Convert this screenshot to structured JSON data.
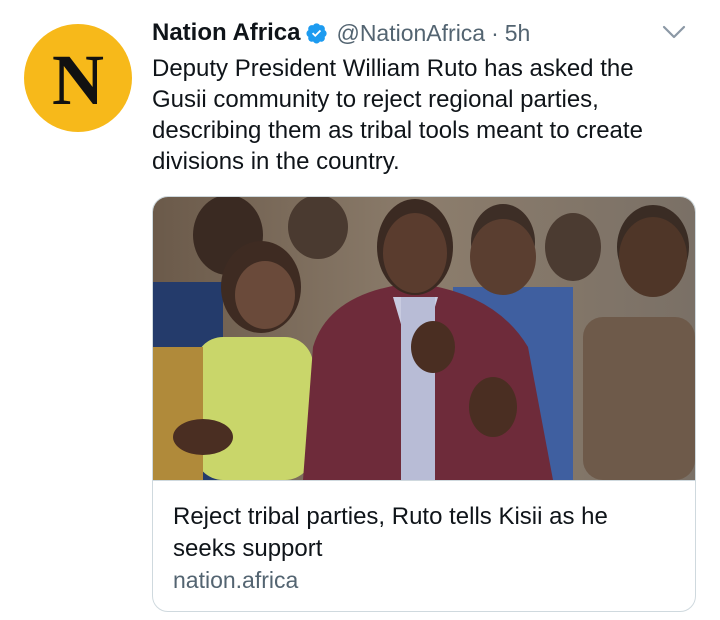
{
  "tweet": {
    "author_name": "Nation Africa",
    "handle": "@NationAfrica",
    "separator": "·",
    "time": "5h",
    "text": "Deputy President William Ruto has asked the Gusii community to reject regional parties, describing them as tribal tools meant to create divisions in the country.",
    "avatar_letter": "N",
    "avatar_color": "#f7b91a",
    "verified_color": "#1d9bf0"
  },
  "card": {
    "title": "Reject tribal parties, Ruto tells Kisii as he seeks support",
    "domain": "nation.africa"
  }
}
